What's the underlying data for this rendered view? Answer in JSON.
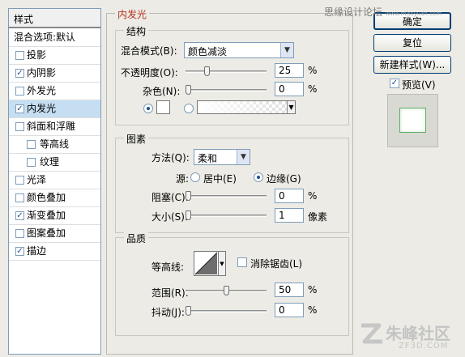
{
  "style_list": {
    "header": "样式",
    "items": [
      {
        "label": "混合选项:默认",
        "checkbox": false,
        "checked": false,
        "selected": false,
        "indent": false
      },
      {
        "label": "投影",
        "checkbox": true,
        "checked": false,
        "selected": false,
        "indent": false
      },
      {
        "label": "内阴影",
        "checkbox": true,
        "checked": true,
        "selected": false,
        "indent": false
      },
      {
        "label": "外发光",
        "checkbox": true,
        "checked": false,
        "selected": false,
        "indent": false
      },
      {
        "label": "内发光",
        "checkbox": true,
        "checked": true,
        "selected": true,
        "indent": false
      },
      {
        "label": "斜面和浮雕",
        "checkbox": true,
        "checked": false,
        "selected": false,
        "indent": false
      },
      {
        "label": "等高线",
        "checkbox": true,
        "checked": false,
        "selected": false,
        "indent": true
      },
      {
        "label": "纹理",
        "checkbox": true,
        "checked": false,
        "selected": false,
        "indent": true
      },
      {
        "label": "光泽",
        "checkbox": true,
        "checked": false,
        "selected": false,
        "indent": false
      },
      {
        "label": "颜色叠加",
        "checkbox": true,
        "checked": false,
        "selected": false,
        "indent": false
      },
      {
        "label": "渐变叠加",
        "checkbox": true,
        "checked": true,
        "selected": false,
        "indent": false
      },
      {
        "label": "图案叠加",
        "checkbox": true,
        "checked": false,
        "selected": false,
        "indent": false
      },
      {
        "label": "描边",
        "checkbox": true,
        "checked": true,
        "selected": false,
        "indent": false
      }
    ]
  },
  "panel": {
    "title": "内发光",
    "structure": {
      "title": "结构",
      "blend_mode_label": "混合模式(B):",
      "blend_mode_value": "颜色减淡",
      "opacity_label": "不透明度(O):",
      "opacity_value": "25",
      "opacity_level": 0.25,
      "noise_label": "杂色(N):",
      "noise_value": "0",
      "noise_level": 0,
      "unit": "%",
      "color_mode": "solid",
      "solid_color": "#ffffff"
    },
    "elements": {
      "title": "图素",
      "method_label": "方法(Q):",
      "method_value": "柔和",
      "source_label": "源:",
      "source_center": "居中(E)",
      "source_edge": "边缘(G)",
      "source_selected": "edge",
      "choke_label": "阻塞(C):",
      "choke_value": "0",
      "choke_level": 0,
      "size_label": "大小(S):",
      "size_value": "1",
      "size_level": 0,
      "percent": "%",
      "pixels": "像素"
    },
    "quality": {
      "title": "品质",
      "contour_label": "等高线:",
      "antialias_label": "消除锯齿(L)",
      "antialias_checked": false,
      "range_label": "范围(R):",
      "range_value": "50",
      "range_level": 0.5,
      "jitter_label": "抖动(J):",
      "jitter_value": "0",
      "jitter_level": 0,
      "unit": "%"
    }
  },
  "buttons": {
    "ok": "确定",
    "reset": "复位",
    "new_style": "新建样式(W)...",
    "preview_label": "预览(V)",
    "preview_checked": true
  },
  "watermark": {
    "top": "思缘设计论坛",
    "top_url": "www.missyuan.com",
    "brand": "朱峰社区",
    "brand_url": "ZF3D.COM"
  },
  "colors": {
    "accent": "#b5321e",
    "selection": "#c6def2",
    "border": "#7f9db9"
  }
}
